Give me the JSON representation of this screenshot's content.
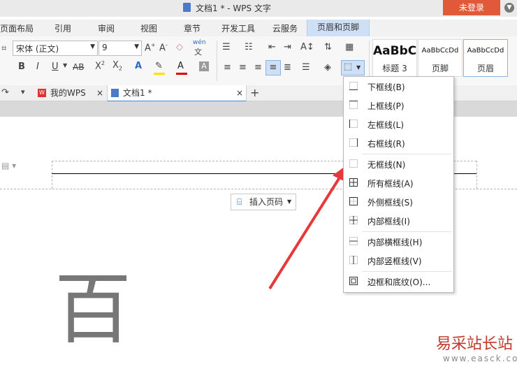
{
  "window": {
    "title": "文档1 * - WPS 文字",
    "login_label": "未登录"
  },
  "menu": {
    "items": [
      "页面布局",
      "引用",
      "审阅",
      "视图",
      "章节",
      "开发工具",
      "云服务",
      "页眉和页脚"
    ],
    "active": "页眉和页脚"
  },
  "toolbar": {
    "font_name": "宋体 (正文)",
    "font_size": "9",
    "styles": [
      {
        "sample": "AaBbC",
        "name": "标题 3"
      },
      {
        "sample": "AaBbCcDd",
        "name": "页脚"
      },
      {
        "sample": "AaBbCcDd",
        "name": "页眉"
      }
    ]
  },
  "tabs": [
    {
      "label": "我的WPS",
      "active": false
    },
    {
      "label": "文档1 *",
      "active": true
    }
  ],
  "document": {
    "insert_page_number_label": "插入页码",
    "body_char": "百"
  },
  "border_menu": {
    "items": [
      "下框线(B)",
      "上框线(P)",
      "左框线(L)",
      "右框线(R)",
      "无框线(N)",
      "所有框线(A)",
      "外侧框线(S)",
      "内部框线(I)",
      "内部横框线(H)",
      "内部竖框线(V)",
      "边框和底纹(O)..."
    ]
  },
  "watermark": {
    "text": "易采站长站",
    "url": "www.easck.com"
  },
  "colors": {
    "login_bg": "#e05a3a",
    "active_tab_underline": "#3d8cd8",
    "arrow": "#e8393a"
  }
}
